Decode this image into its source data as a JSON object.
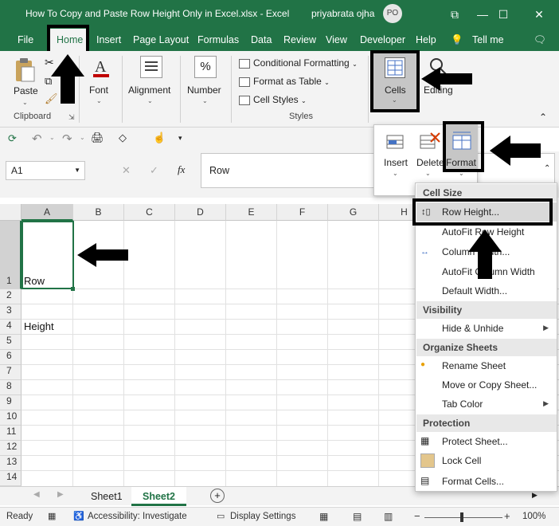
{
  "window": {
    "title": "How To Copy and Paste Row Height Only in Excel.xlsx  -  Excel",
    "user": "priyabrata ojha",
    "avatar": "PO"
  },
  "menu": {
    "file": "File",
    "home": "Home",
    "insert": "Insert",
    "page_layout": "Page Layout",
    "formulas": "Formulas",
    "data": "Data",
    "review": "Review",
    "view": "View",
    "developer": "Developer",
    "help": "Help",
    "tell_me": "Tell me"
  },
  "ribbon": {
    "paste": "Paste",
    "clipboard": "Clipboard",
    "font": "Font",
    "alignment": "Alignment",
    "number": "Number",
    "number_symbol": "%",
    "conditional_formatting": "Conditional Formatting",
    "format_as_table": "Format as Table",
    "cell_styles": "Cell Styles",
    "styles": "Styles",
    "cells": "Cells",
    "editing": "Editing"
  },
  "cells_dropdown": {
    "insert": "Insert",
    "delete": "Delete",
    "format": "Format"
  },
  "formula_bar": {
    "name_box": "A1",
    "fx": "fx",
    "content": "Row"
  },
  "grid": {
    "columns": [
      "A",
      "B",
      "C",
      "D",
      "E",
      "F",
      "G",
      "H"
    ],
    "rows": [
      "1",
      "2",
      "3",
      "4",
      "5",
      "6",
      "7",
      "8",
      "9",
      "10",
      "11",
      "12",
      "13",
      "14"
    ],
    "cells": {
      "A1": "Row",
      "A4": "Height"
    }
  },
  "format_menu": {
    "cell_size": "Cell Size",
    "row_height": "Row Height...",
    "autofit_row_height": "AutoFit Row Height",
    "column_width": "Column Width...",
    "autofit_column_width": "AutoFit Column Width",
    "default_width": "Default Width...",
    "visibility": "Visibility",
    "hide_unhide": "Hide & Unhide",
    "organize_sheets": "Organize Sheets",
    "rename_sheet": "Rename Sheet",
    "move_copy_sheet": "Move or Copy Sheet...",
    "tab_color": "Tab Color",
    "protection": "Protection",
    "protect_sheet": "Protect Sheet...",
    "lock_cell": "Lock Cell",
    "format_cells": "Format Cells..."
  },
  "sheets": {
    "tab1": "Sheet1",
    "tab2": "Sheet2",
    "active": "Sheet2"
  },
  "status": {
    "ready": "Ready",
    "accessibility": "Accessibility: Investigate",
    "display_settings": "Display Settings",
    "zoom": "100%"
  },
  "colors": {
    "excel_green": "#217346",
    "highlight": "#000000",
    "ribbon_bg": "#f3f3f3"
  }
}
